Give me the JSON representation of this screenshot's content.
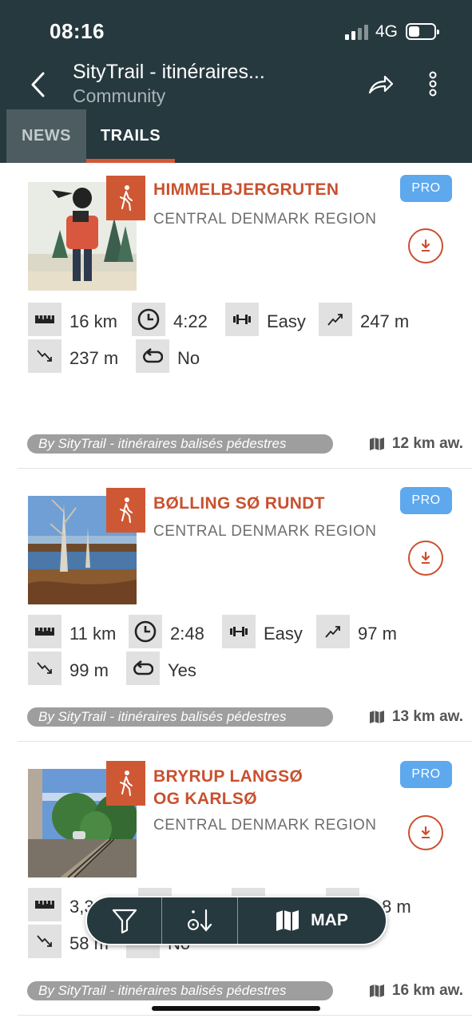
{
  "status_bar": {
    "time": "08:16",
    "network": "4G"
  },
  "header": {
    "title": "SityTrail - itinéraires...",
    "subtitle": "Community"
  },
  "tabs": [
    {
      "label": "NEWS"
    },
    {
      "label": "TRAILS"
    }
  ],
  "trails": [
    {
      "name_lines": [
        "HIMMELBJERGRUTEN"
      ],
      "region": "CENTRAL DENMARK REGION",
      "badge": "PRO",
      "distance": "16 km",
      "duration": "4:22",
      "difficulty": "Easy",
      "ascent": "247 m",
      "descent": "237 m",
      "loop": "No",
      "author": "By SityTrail - itinéraires balisés pédestres",
      "away": "12 km aw."
    },
    {
      "name_lines": [
        "BØLLING SØ RUNDT"
      ],
      "region": "CENTRAL DENMARK REGION",
      "badge": "PRO",
      "distance": "11 km",
      "duration": "2:48",
      "difficulty": "Easy",
      "ascent": "97 m",
      "descent": "99 m",
      "loop": "Yes",
      "author": "By SityTrail - itinéraires balisés pédestres",
      "away": "13 km aw."
    },
    {
      "name_lines": [
        "BRYRUP LANGSØ",
        "OG KARLSØ"
      ],
      "region": "CENTRAL DENMARK REGION",
      "badge": "PRO",
      "distance": "3,3",
      "ascent": "8 m",
      "descent": "58 m",
      "loop": "No",
      "author": "By SityTrail - itinéraires balisés pédestres",
      "away": "16 km aw."
    }
  ],
  "bottom_bar": {
    "map_label": "MAP"
  },
  "colors": {
    "header_bg": "#26393f",
    "accent": "#cf5834",
    "pro": "#5ea8ee"
  }
}
